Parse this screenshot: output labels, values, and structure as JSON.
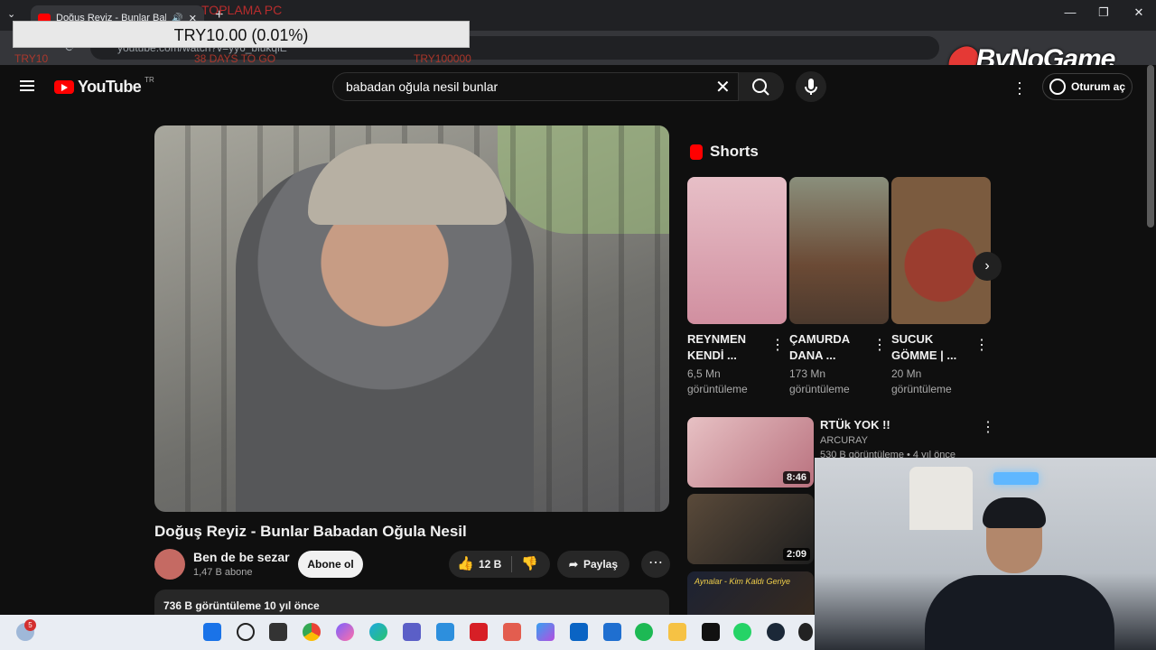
{
  "browser": {
    "tab_title": "Doğuş Reyiz - Bunlar Babad",
    "url": "youtube.com/watch?v=yy6_biukqiE",
    "controls": {
      "minimize": "—",
      "maximize": "❐",
      "close": "✕"
    }
  },
  "overlay": {
    "donation_amount": "TRY10.00 (0.01%)",
    "goal_title": "TOPLAMA PC",
    "goal_left": "TRY10",
    "goal_days": "38 DAYS TO GO",
    "goal_target": "TRY100000",
    "brand": "ByNoGame"
  },
  "header": {
    "logo_text": "YouTube",
    "country_code": "TR",
    "search_value": "babadan oğula nesil bunlar",
    "signin_label": "Oturum aç"
  },
  "video": {
    "title": "Doğuş Reyiz - Bunlar Babadan Oğula Nesil",
    "channel": "Ben de be sezar",
    "subscribers": "1,47 B abone",
    "subscribe_label": "Abone ol",
    "likes": "12 B",
    "share_label": "Paylaş",
    "meta": "736 B görüntüleme  10 yıl önce"
  },
  "shorts": {
    "heading": "Shorts",
    "items": [
      {
        "title": "REYNMEN KENDİ ...",
        "views": "6,5 Mn görüntüleme",
        "color": "#d9a7b0"
      },
      {
        "title": "ÇAMURDA DANA ...",
        "views": "173 Mn görüntüleme",
        "color": "#7a5a45"
      },
      {
        "title": "SUCUK GÖMME | ...",
        "views": "20 Mn görüntüleme",
        "color": "#8b4a3a"
      }
    ]
  },
  "recommendations": [
    {
      "title": "RTÜk YOK !!",
      "channel": "ARCURAY",
      "meta": "530 B görüntüleme • 4 yıl önce",
      "duration": "8:46"
    },
    {
      "title": "",
      "channel": "",
      "meta": "",
      "duration": "2:09"
    },
    {
      "title": "",
      "channel": "",
      "meta": "",
      "duration": "",
      "thumb_text": "Aynalar - Kim Kaldı Geriye"
    }
  ],
  "taskbar": {
    "notification_count": "5"
  }
}
